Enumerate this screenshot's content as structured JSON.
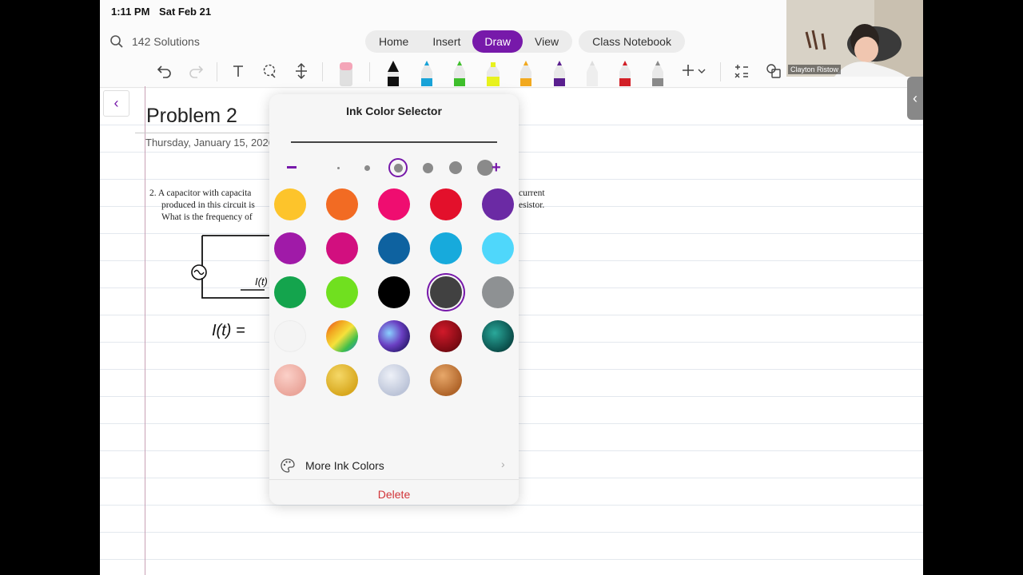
{
  "status": {
    "time": "1:11 PM",
    "date": "Sat Feb 21"
  },
  "search": {
    "label": "142 Solutions"
  },
  "tabs": {
    "items": [
      {
        "label": "Home"
      },
      {
        "label": "Insert"
      },
      {
        "label": "Draw",
        "active": true
      },
      {
        "label": "View"
      }
    ],
    "notebook_label": "Class Notebook"
  },
  "page": {
    "title": "Problem 2",
    "date": "Thursday, January 15, 2026",
    "problem_left": [
      "2.  A capacitor with capacita",
      "produced in this circuit is",
      "What is the frequency of"
    ],
    "problem_right": [
      "current",
      "esistor."
    ],
    "handwriting_label": "I(t)",
    "handwriting_eq": "I(t) ="
  },
  "popover": {
    "title": "Ink Color Selector",
    "selected_size_index": 2,
    "swatches": [
      [
        "#fdc42b",
        "#f26b23",
        "#ef0d70",
        "#e3102b",
        "#6b2aa4"
      ],
      [
        "#a01aa8",
        "#d20f7f",
        "#0e62a0",
        "#17aadc",
        "#4fd7fb"
      ],
      [
        "#14a44d",
        "#70e01f",
        "#000000",
        "#414141",
        "#8e9193"
      ],
      [
        "#f4f4f4",
        "rainbow",
        "galaxy",
        "ruby",
        "emerald"
      ],
      [
        "rosegold",
        "gold",
        "silver",
        "bronze"
      ]
    ],
    "selected_swatch": "#414141",
    "more_label": "More Ink Colors",
    "delete_label": "Delete"
  },
  "webcam": {
    "name": "Clayton Ristow"
  },
  "colors": {
    "accent": "#7719aa",
    "delete": "#d13438"
  }
}
